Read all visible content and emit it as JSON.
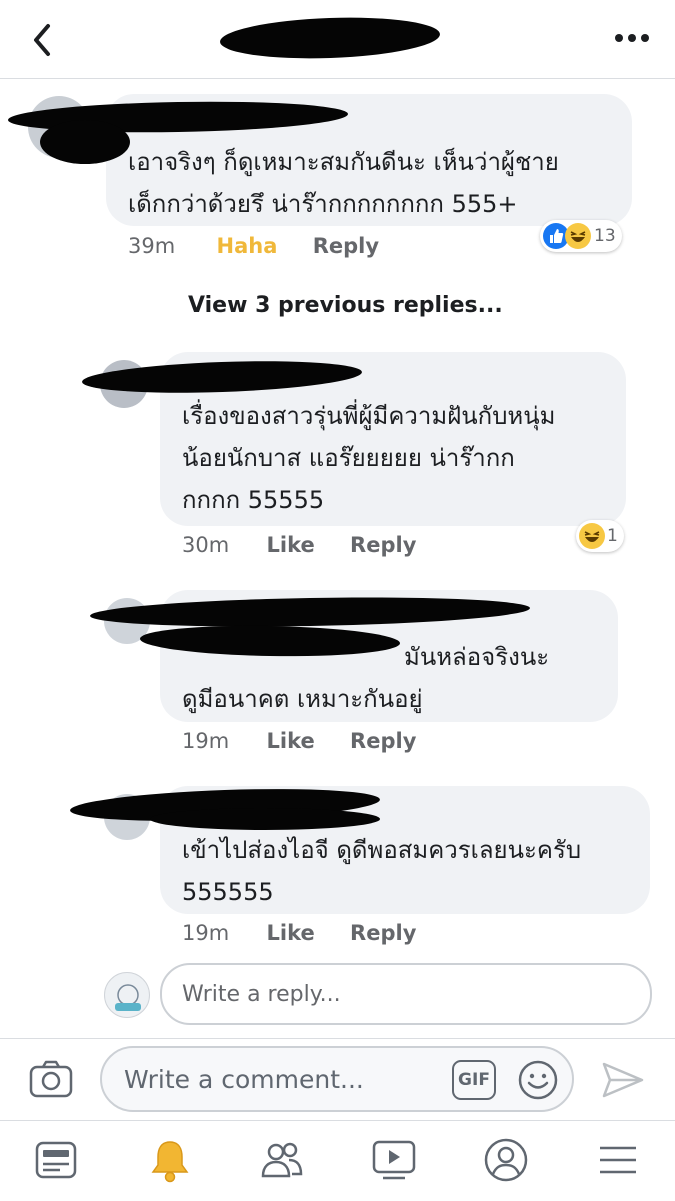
{
  "comments": [
    {
      "text": "เอาจริงๆ ก็ดูเหมาะสมกันดีนะ เห็นว่าผู้ชาย\nเด็กกว่าด้วยรึ น่าร๊ากกกกกกกก 555+",
      "time": "39m",
      "reaction_label": "Haha",
      "reply_label": "Reply",
      "reaction_count": "13"
    },
    {
      "text": "เรื่องของสาวรุ่นพี่ผู้มีความฝันกับหนุ่ม\nน้อยนักบาส แอร๊ยยยยย น่าร๊ากก\nกกกก 55555",
      "time": "30m",
      "like_label": "Like",
      "reply_label": "Reply",
      "reaction_count": "1"
    },
    {
      "text": "มันหล่อจริงนะ\nดูมีอนาคต เหมาะกันอยู่",
      "time": "19m",
      "like_label": "Like",
      "reply_label": "Reply"
    },
    {
      "text": "เข้าไปส่องไอจี ดูดีพอสมควรเลยนะครับ\n555555",
      "time": "19m",
      "like_label": "Like",
      "reply_label": "Reply"
    }
  ],
  "view_previous": "View 3 previous replies...",
  "reply_input": {
    "placeholder": "Write a reply..."
  },
  "composer": {
    "placeholder": "Write a comment...",
    "gif_label": "GIF"
  },
  "icons": {
    "back": "chevron-left-icon",
    "more": "more-dots-icon",
    "camera": "camera-icon",
    "gif": "gif-icon",
    "emoji": "emoji-icon",
    "send": "send-icon",
    "tabs": [
      "news-feed-icon",
      "notifications-bell-icon",
      "friends-icon",
      "watch-icon",
      "profile-icon",
      "menu-icon"
    ]
  },
  "colors": {
    "haha_label": "#f0b83a",
    "like_blue": "#1877f2",
    "bell_yellow": "#f2b632",
    "bubble_bg": "#f0f2f5",
    "meta_gray": "#65676b"
  }
}
